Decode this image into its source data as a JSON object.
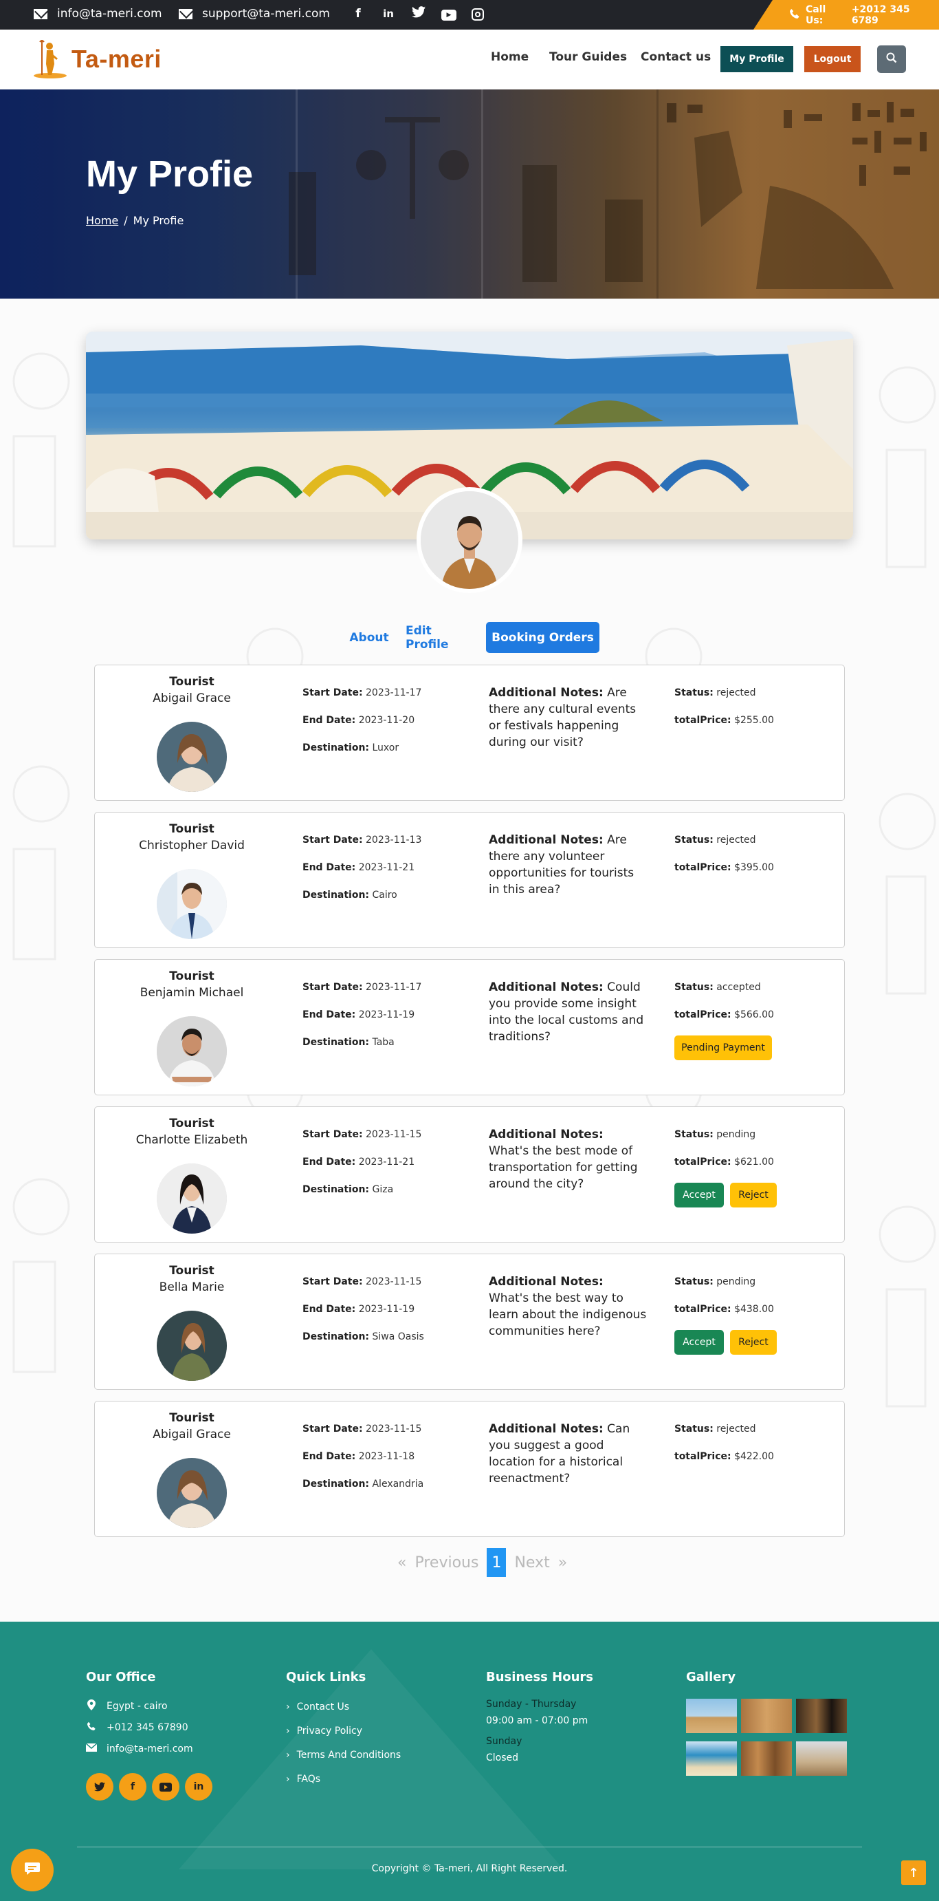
{
  "topbar": {
    "email_primary": "info@ta-meri.com",
    "email_support": "support@ta-meri.com",
    "social_icons": [
      "facebook-icon",
      "linkedin-icon",
      "twitter-icon",
      "youtube-icon",
      "instagram-icon"
    ],
    "call_label": "Call Us:",
    "call_number": "+2012 345 6789"
  },
  "nav": {
    "logo_text": "Ta-meri",
    "links": [
      "Home",
      "Tour Guides",
      "Contact us"
    ],
    "profile_button": "My Profile",
    "logout_button": "Logout"
  },
  "hero": {
    "title": "My Profie",
    "breadcrumb_home": "Home",
    "breadcrumb_sep": "/",
    "breadcrumb_current": "My Profie"
  },
  "tabs": {
    "about": "About",
    "edit_profile": "Edit Profile",
    "booking_orders": "Booking Orders"
  },
  "labels": {
    "tourist": "Tourist",
    "start_date": "Start Date:",
    "end_date": "End Date:",
    "destination": "Destination:",
    "additional_notes": "Additional Notes:",
    "status": "Status:",
    "total_price": "totalPrice:"
  },
  "bookings": [
    {
      "name": "Abigail Grace",
      "start": "2023-11-17",
      "end": "2023-11-20",
      "destination": "Luxor",
      "notes": "Are there any cultural events or festivals happening during our visit?",
      "status": "rejected",
      "price": "$255.00"
    },
    {
      "name": "Christopher David",
      "start": "2023-11-13",
      "end": "2023-11-21",
      "destination": "Cairo",
      "notes": "Are there any volunteer opportunities for tourists in this area?",
      "status": "rejected",
      "price": "$395.00"
    },
    {
      "name": "Benjamin Michael",
      "start": "2023-11-17",
      "end": "2023-11-19",
      "destination": "Taba",
      "notes": "Could you provide some insight into the local customs and traditions?",
      "status": "accepted",
      "price": "$566.00",
      "action": "Pending Payment"
    },
    {
      "name": "Charlotte Elizabeth",
      "start": "2023-11-15",
      "end": "2023-11-21",
      "destination": "Giza",
      "notes": "What's the best mode of transportation for getting around the city?",
      "status": "pending",
      "price": "$621.00",
      "accept": "Accept",
      "reject": "Reject"
    },
    {
      "name": "Bella Marie",
      "start": "2023-11-15",
      "end": "2023-11-19",
      "destination": "Siwa Oasis",
      "notes": "What's the best way to learn about the indigenous communities here?",
      "status": "pending",
      "price": "$438.00",
      "accept": "Accept",
      "reject": "Reject"
    },
    {
      "name": "Abigail Grace",
      "start": "2023-11-15",
      "end": "2023-11-18",
      "destination": "Alexandria",
      "notes": "Can you suggest a good location for a historical reenactment?",
      "status": "rejected",
      "price": "$422.00"
    }
  ],
  "pagination": {
    "prev_arrows": "«",
    "prev": "Previous",
    "current": "1",
    "next": "Next",
    "next_arrows": "»"
  },
  "footer": {
    "office_title": "Our Office",
    "office_location": "Egypt - cairo",
    "office_phone": "+012 345 67890",
    "office_email": "info@ta-meri.com",
    "quick_links_title": "Quick Links",
    "quick_links": [
      "Contact Us",
      "Privacy Policy",
      "Terms And Conditions",
      "FAQs"
    ],
    "hours_title": "Business Hours",
    "hours_days1": "Sunday - Thursday",
    "hours_time1": "09:00 am - 07:00 pm",
    "hours_days2": "Sunday",
    "hours_time2": "Closed",
    "gallery_title": "Gallery",
    "copyright": "Copyright © Ta-meri, All Right Reserved."
  },
  "colors": {
    "brand_orange": "#f59f16",
    "logo_brown": "#c35b12",
    "accent_blue": "#1f7ae0",
    "profile_teal": "#0d4f55",
    "logout": "#c9541b",
    "footer_teal": "#1f8f82"
  }
}
